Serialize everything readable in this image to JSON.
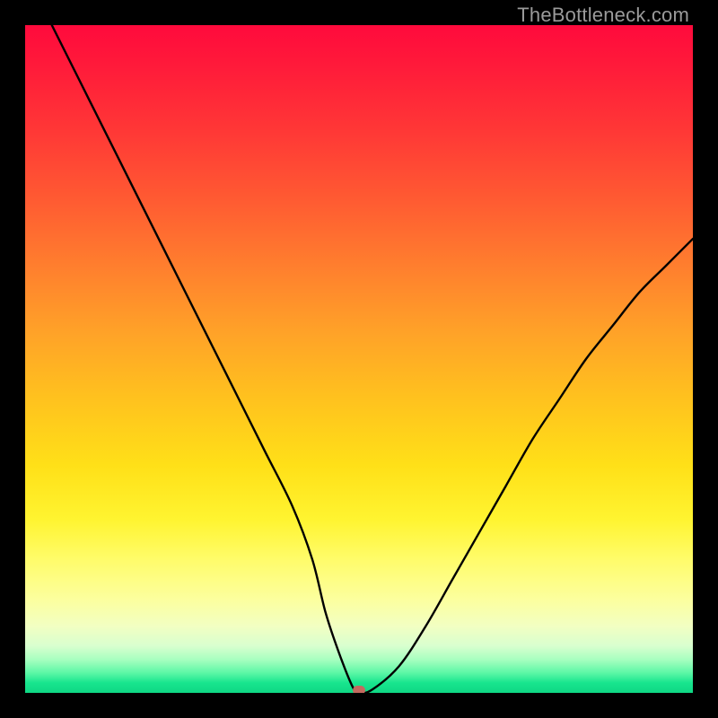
{
  "watermark": "TheBottleneck.com",
  "chart_data": {
    "type": "line",
    "title": "",
    "xlabel": "",
    "ylabel": "",
    "xlim": [
      0,
      100
    ],
    "ylim": [
      0,
      100
    ],
    "grid": false,
    "legend": false,
    "series": [
      {
        "name": "bottleneck-curve",
        "x": [
          4,
          8,
          12,
          16,
          20,
          24,
          28,
          32,
          36,
          40,
          43,
          45,
          47,
          49,
          50,
          52,
          56,
          60,
          64,
          68,
          72,
          76,
          80,
          84,
          88,
          92,
          96,
          100
        ],
        "y": [
          100,
          92,
          84,
          76,
          68,
          60,
          52,
          44,
          36,
          28,
          20,
          12,
          6,
          1,
          0,
          0.5,
          4,
          10,
          17,
          24,
          31,
          38,
          44,
          50,
          55,
          60,
          64,
          68
        ]
      }
    ],
    "optimum_marker": {
      "x": 50,
      "y": 0
    },
    "background_gradient": {
      "top": "#ff0a3c",
      "mid": "#ffe018",
      "bottom": "#0fd784"
    }
  }
}
